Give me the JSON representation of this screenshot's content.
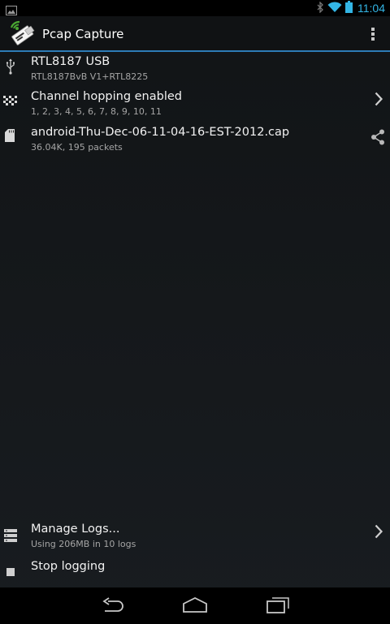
{
  "status_bar": {
    "time": "11:04",
    "left_icon": "gallery-icon",
    "right_icons": [
      "bluetooth-icon",
      "wifi-icon",
      "battery-icon"
    ]
  },
  "app_bar": {
    "title": "Pcap Capture",
    "app_icon": "usb-wifi-dongle-icon",
    "menu_icon": "overflow-menu-icon"
  },
  "list": [
    {
      "icon": "usb-icon",
      "title": "RTL8187 USB",
      "subtitle": "RTL8187BvB V1+RTL8225"
    },
    {
      "icon": "channel-hopping-icon",
      "title": "Channel hopping enabled",
      "subtitle": "1, 2, 3, 4, 5, 6, 7, 8, 9, 10, 11",
      "trailing": "chevron-right-icon"
    },
    {
      "icon": "sd-card-icon",
      "title": "android-Thu-Dec-06-11-04-16-EST-2012.cap",
      "subtitle": "36.04K, 195 packets",
      "trailing": "share-icon"
    }
  ],
  "footer": {
    "manage_logs": {
      "icon": "logs-icon",
      "title": "Manage Logs...",
      "subtitle": "Using 206MB in 10 logs",
      "trailing": "chevron-right-icon"
    },
    "stop_logging": {
      "icon": "stop-icon",
      "title": "Stop logging"
    }
  },
  "nav_bar": [
    "back-icon",
    "home-icon",
    "recents-icon"
  ],
  "colors": {
    "accent": "#33b5e5",
    "divider": "#2d7cb7",
    "background": "#15181b"
  }
}
